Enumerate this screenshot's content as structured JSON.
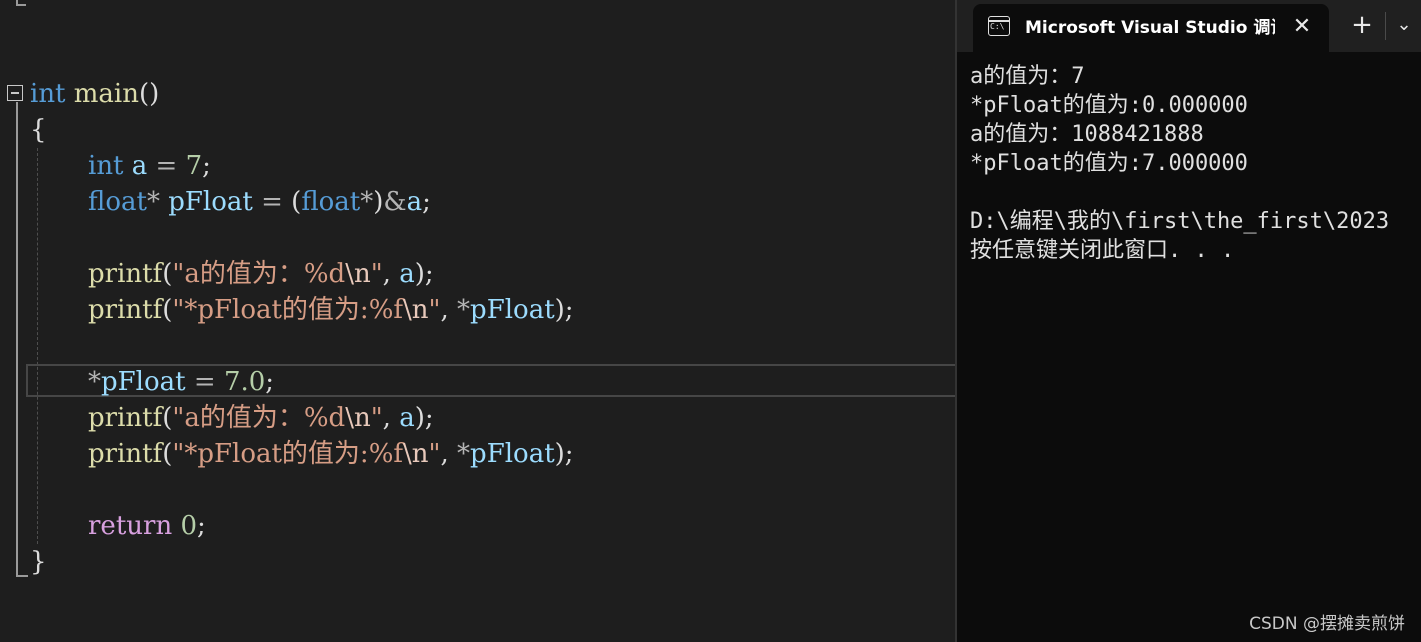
{
  "editor": {
    "code_lines": [
      [
        [
          "kw",
          "int"
        ],
        [
          "pun",
          " "
        ],
        [
          "fn",
          "main"
        ],
        [
          "pun",
          "()"
        ]
      ],
      [
        [
          "pun",
          "{"
        ]
      ],
      [
        [
          "kw",
          "int"
        ],
        [
          "pun",
          " "
        ],
        [
          "var",
          "a"
        ],
        [
          "op",
          " = "
        ],
        [
          "num",
          "7"
        ],
        [
          "pun",
          ";"
        ]
      ],
      [
        [
          "kw",
          "float"
        ],
        [
          "op",
          "*"
        ],
        [
          "pun",
          " "
        ],
        [
          "var",
          "pFloat"
        ],
        [
          "op",
          " = "
        ],
        [
          "pun",
          "("
        ],
        [
          "kw",
          "float"
        ],
        [
          "op",
          "*"
        ],
        [
          "pun",
          ")"
        ],
        [
          "op",
          "&"
        ],
        [
          "var",
          "a"
        ],
        [
          "pun",
          ";"
        ]
      ],
      [],
      [
        [
          "fn",
          "printf"
        ],
        [
          "pun",
          "("
        ],
        [
          "str",
          "\"a的值为：%d"
        ],
        [
          "esc",
          "\\n"
        ],
        [
          "str",
          "\""
        ],
        [
          "pun",
          ", "
        ],
        [
          "var",
          "a"
        ],
        [
          "pun",
          ");"
        ]
      ],
      [
        [
          "fn",
          "printf"
        ],
        [
          "pun",
          "("
        ],
        [
          "str",
          "\"*pFloat的值为:%f"
        ],
        [
          "esc",
          "\\n"
        ],
        [
          "str",
          "\""
        ],
        [
          "pun",
          ", "
        ],
        [
          "op",
          "*"
        ],
        [
          "var",
          "pFloat"
        ],
        [
          "pun",
          ");"
        ]
      ],
      [],
      [
        [
          "op",
          "*"
        ],
        [
          "var",
          "pFloat"
        ],
        [
          "op",
          " = "
        ],
        [
          "num",
          "7.0"
        ],
        [
          "pun",
          ";"
        ]
      ],
      [
        [
          "fn",
          "printf"
        ],
        [
          "pun",
          "("
        ],
        [
          "str",
          "\"a的值为：%d"
        ],
        [
          "esc",
          "\\n"
        ],
        [
          "str",
          "\""
        ],
        [
          "pun",
          ", "
        ],
        [
          "var",
          "a"
        ],
        [
          "pun",
          ");"
        ]
      ],
      [
        [
          "fn",
          "printf"
        ],
        [
          "pun",
          "("
        ],
        [
          "str",
          "\"*pFloat的值为:%f"
        ],
        [
          "esc",
          "\\n"
        ],
        [
          "str",
          "\""
        ],
        [
          "pun",
          ", "
        ],
        [
          "op",
          "*"
        ],
        [
          "var",
          "pFloat"
        ],
        [
          "pun",
          ");"
        ]
      ],
      [],
      [
        [
          "kwctl",
          "return"
        ],
        [
          "pun",
          " "
        ],
        [
          "num",
          "0"
        ],
        [
          "pun",
          ";"
        ]
      ],
      [
        [
          "pun",
          "}"
        ]
      ]
    ]
  },
  "console": {
    "tab_title": "Microsoft Visual Studio 调试控制台",
    "tab_icon_text": "C:\\",
    "close_glyph": "✕",
    "new_tab_glyph": "+",
    "dropdown_glyph": "⌄",
    "lines": [
      "a的值为：7",
      "*pFloat的值为:0.000000",
      "a的值为：1088421888",
      "*pFloat的值为:7.000000",
      "",
      "D:\\编程\\我的\\first\\the_first\\2023",
      "按任意键关闭此窗口. . ."
    ]
  },
  "watermark": "CSDN @摆摊卖煎饼",
  "colors": {
    "editor_background": "#1e1e1e",
    "console_background": "#0c0c0c",
    "keyword": "#569cd6",
    "function": "#dcdcaa",
    "variable": "#9cdcfe",
    "string": "#d69d85",
    "number": "#b5cea8"
  }
}
